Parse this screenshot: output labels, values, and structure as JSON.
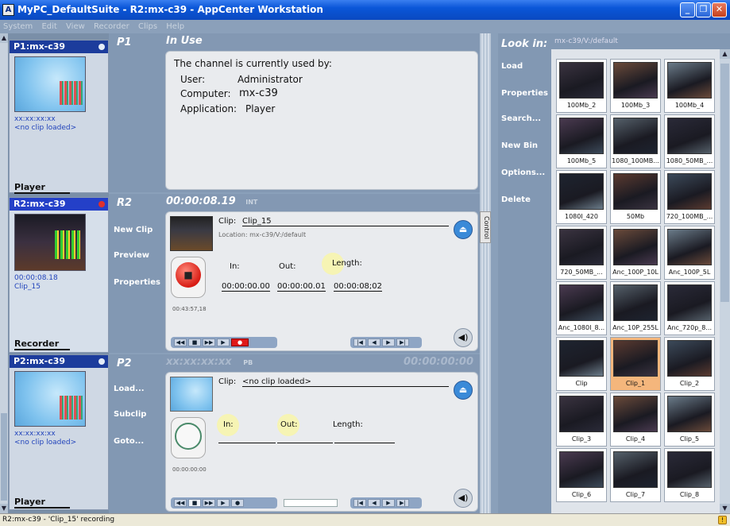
{
  "window": {
    "title": "MyPC_DefaultSuite - R2:mx-c39 - AppCenter Workstation",
    "icon_letter": "A",
    "min": "_",
    "max": "❐",
    "close": "✕"
  },
  "menu": [
    "System",
    "Edit",
    "View",
    "Recorder",
    "Clips",
    "Help"
  ],
  "slots": [
    {
      "header": "P1:mx-c39",
      "tc": "xx:xx:xx:xx",
      "clip": "<no clip loaded>",
      "label": "Player"
    },
    {
      "header": "R2:mx-c39",
      "tc": "00:00:08.18",
      "clip": "Clip_15",
      "label": "Recorder"
    },
    {
      "header": "P2:mx-c39",
      "tc": "xx:xx:xx:xx",
      "clip": "<no clip loaded>",
      "label": "Player"
    }
  ],
  "p1": {
    "name": "P1",
    "title": "In Use",
    "msg": "The channel is currently used by:",
    "user_label": "User:",
    "user": "Administrator",
    "computer_label": "Computer:",
    "computer": "mx-c39",
    "app_label": "Application:",
    "app": "Player"
  },
  "r2": {
    "name": "R2",
    "timecode": "00:00:08.19",
    "tc_tag": "INT",
    "buttons": [
      "New Clip",
      "Preview",
      "Properties"
    ],
    "clip_label": "Clip:",
    "clip": "Clip_15",
    "location": "Location: mx-c39/V:/default",
    "in_label": "In:",
    "out_label": "Out:",
    "length_label": "Length:",
    "in": "00:00:00.00",
    "out": "00:00:00.01",
    "length": "00:00:08;02",
    "remaining": "00:43:57,18"
  },
  "p2": {
    "name": "P2",
    "timecode": "xx:xx:xx:xx",
    "tc_tag": "PB",
    "right_tc": "00:00:00:00",
    "buttons": [
      "Load...",
      "Subclip",
      "Goto..."
    ],
    "clip_label": "Clip:",
    "clip": "<no clip loaded>",
    "in_label": "In:",
    "out_label": "Out:",
    "length_label": "Length:",
    "remaining": "00:00:00:00"
  },
  "control_tab": "Control",
  "bin": {
    "look_in": "Look in:",
    "path": "mx-c39/V:/default",
    "buttons": [
      "Load",
      "Properties",
      "Search...",
      "New Bin",
      "Options...",
      "Delete"
    ],
    "clips": [
      "100Mb_2",
      "100Mb_3",
      "100Mb_4",
      "100Mb_5",
      "1080_100MB...",
      "1080_50MB_...",
      "1080I_420",
      "50Mb",
      "720_100MB_...",
      "720_50MB_...",
      "Anc_100P_10L",
      "Anc_100P_5L",
      "Anc_1080I_8...",
      "Anc_10P_255L",
      "Anc_720p_8...",
      "Clip",
      "Clip_1",
      "Clip_2",
      "Clip_3",
      "Clip_4",
      "Clip_5",
      "Clip_6",
      "Clip_7",
      "Clip_8"
    ],
    "selected": "Clip_1"
  },
  "status": "R2:mx-c39 - 'Clip_15' recording"
}
